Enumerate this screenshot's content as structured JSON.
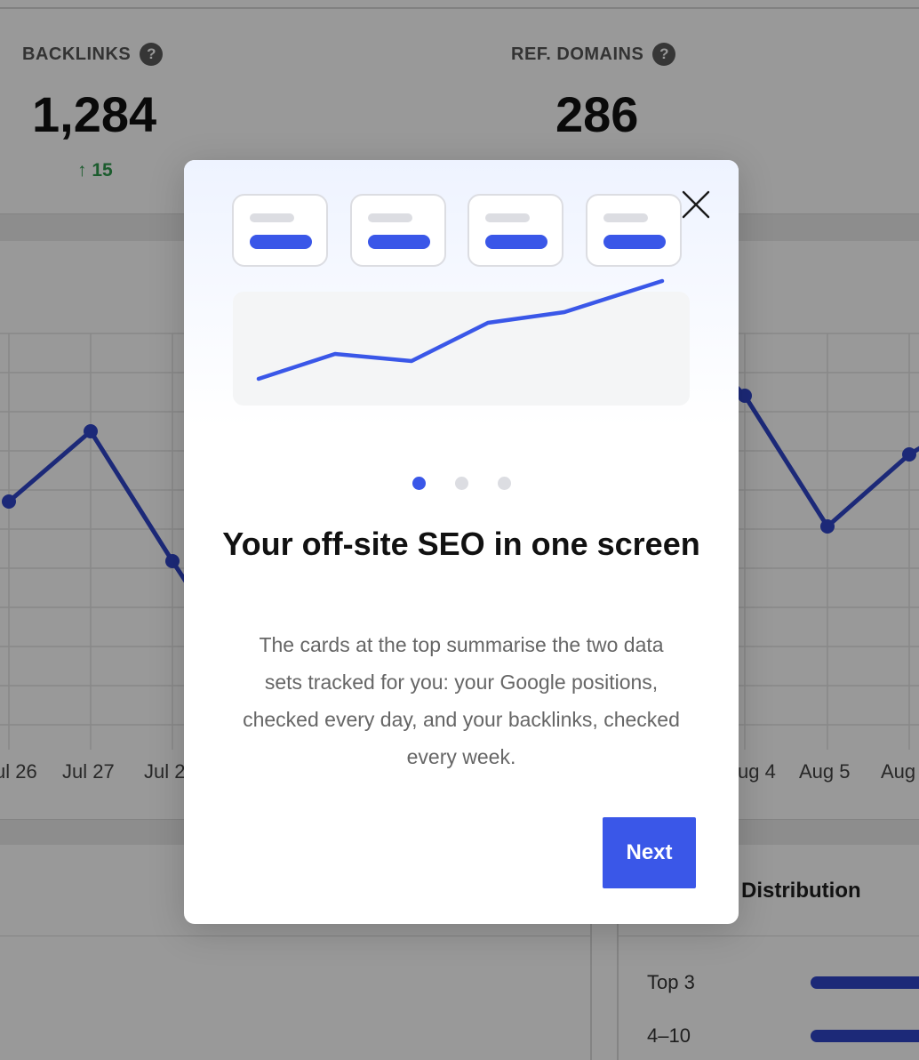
{
  "dashboard": {
    "metrics": [
      {
        "label": "BACKLINKS",
        "value": "1,284",
        "delta": "↑ 15"
      },
      {
        "label": "REF. DOMAINS",
        "value": "286"
      }
    ],
    "help_icon_glyph": "?",
    "chart": {
      "x_tick_labels_visible": [
        "ul 26",
        "Jul 27",
        "Jul 2",
        "ug 4",
        "Aug 5",
        "Aug"
      ],
      "series_color": "#2f45c9"
    },
    "distribution": {
      "title": "Distribution",
      "rows": [
        {
          "label": "Top 3"
        },
        {
          "label": "4–10"
        }
      ]
    }
  },
  "modal": {
    "title": "Your off-site SEO in one screen",
    "body": "The cards at the top summarise the two data sets tracked for you: your Google positions, checked every day, and your backlinks, checked every week.",
    "next_label": "Next",
    "pagination": {
      "total": 3,
      "active_index": 0
    },
    "close_icon": "close-icon",
    "accent_color": "#3a57e8"
  }
}
